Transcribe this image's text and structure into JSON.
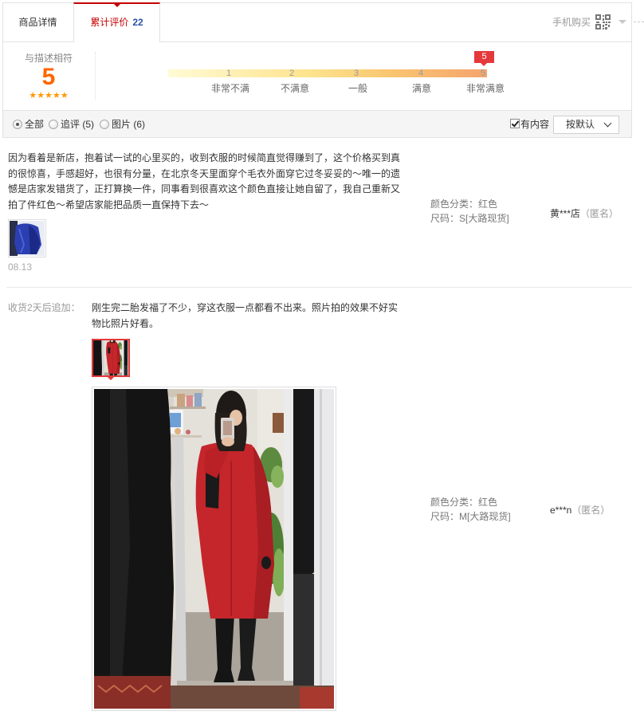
{
  "tabs": [
    {
      "label": "商品详情"
    },
    {
      "label": "累计评价",
      "count": "22"
    }
  ],
  "header": {
    "mobile_buy": "手机购买",
    "qr_icon": "qr-code-icon"
  },
  "rating": {
    "label": "与描述相符",
    "score": "5",
    "star_count": 5,
    "scale": [
      {
        "num": "1",
        "label": "非常不满"
      },
      {
        "num": "2",
        "label": "不满意"
      },
      {
        "num": "3",
        "label": "一般"
      },
      {
        "num": "4",
        "label": "满意"
      },
      {
        "num": "5",
        "label": "非常满意"
      }
    ],
    "marker": "5"
  },
  "filters": {
    "options": [
      {
        "label": "全部",
        "selected": true
      },
      {
        "label": "追评 (5)",
        "selected": false
      },
      {
        "label": "图片 (6)",
        "selected": false
      }
    ],
    "has_content": {
      "label": "有内容",
      "checked": true
    },
    "sort": {
      "selected": "按默认"
    }
  },
  "reviews": [
    {
      "text": "因为看着是新店，抱着试一试的心里买的，收到衣服的时候简直觉得赚到了，这个价格买到真的很惊喜，手感超好，也很有分量，在北京冬天里面穿个毛衣外面穿它过冬妥妥的～唯一的遗憾是店家发错货了，正打算换一件，同事看到很喜欢这个颜色直接让她自留了，我自己重新又拍了件红色～希望店家能把品质一直保持下去～",
      "date": "08.13",
      "sku": {
        "color": "颜色分类：红色",
        "size": "尺码：S[大路现货]"
      },
      "user": {
        "name": "黄***店",
        "anonymous": "（匿名）"
      }
    },
    {
      "append": {
        "label": "收货2天后追加：",
        "text": "刚生完二胎发福了不少，穿这衣服一点都看不出来。照片拍的效果不好实物比照片好看。"
      },
      "sku": {
        "color": "颜色分类：红色",
        "size": "尺码：M[大路现货]"
      },
      "user": {
        "name": "e***n",
        "anonymous": "（匿名）"
      }
    }
  ],
  "colors": {
    "accent_red": "#c40000",
    "score_orange": "#ff6600",
    "star_orange": "#ff9900",
    "flag_red": "#e4393c",
    "count_blue": "#2953a6",
    "scale_gradient_start": "#fffbd5",
    "scale_gradient_end": "#f5a46d"
  }
}
